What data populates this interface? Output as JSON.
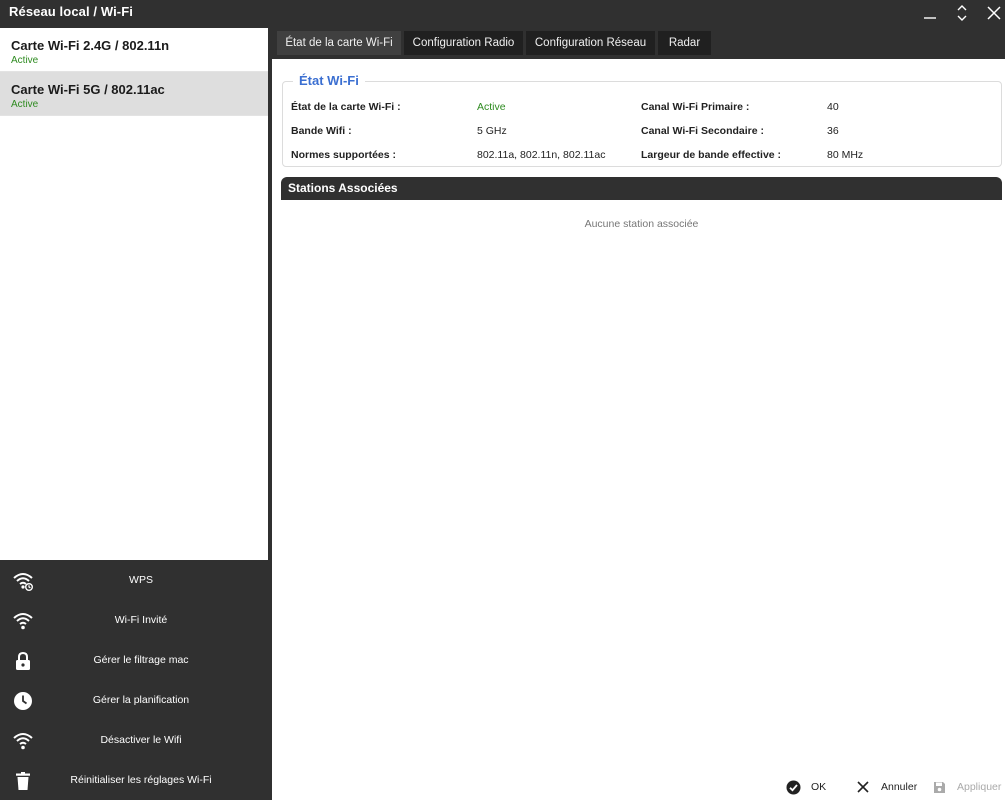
{
  "window": {
    "title": "Réseau local / Wi-Fi"
  },
  "sidebar": {
    "cards": [
      {
        "name": "Carte Wi-Fi 2.4G / 802.11n",
        "status": "Active"
      },
      {
        "name": "Carte Wi-Fi 5G / 802.11ac",
        "status": "Active"
      }
    ],
    "actions": [
      {
        "label": "WPS",
        "icon": "wps-icon"
      },
      {
        "label": "Wi-Fi Invité",
        "icon": "wifi-icon"
      },
      {
        "label": "Gérer le filtrage mac",
        "icon": "lock-icon"
      },
      {
        "label": "Gérer la planification",
        "icon": "clock-icon"
      },
      {
        "label": "Désactiver le Wifi",
        "icon": "wifi-icon"
      },
      {
        "label": "Réinitialiser les réglages Wi-Fi",
        "icon": "trash-icon"
      }
    ]
  },
  "tabs": [
    {
      "label": "État de la carte Wi-Fi"
    },
    {
      "label": "Configuration Radio"
    },
    {
      "label": "Configuration Réseau"
    },
    {
      "label": "Radar"
    }
  ],
  "wifi_state": {
    "legend": "État Wi-Fi",
    "left": [
      {
        "label": "État de la carte Wi-Fi :",
        "value": "Active"
      },
      {
        "label": "Bande Wifi :",
        "value": "5 GHz"
      },
      {
        "label": "Normes supportées :",
        "value": "802.11a, 802.11n, 802.11ac"
      }
    ],
    "right": [
      {
        "label": "Canal Wi-Fi Primaire :",
        "value": "40"
      },
      {
        "label": "Canal Wi-Fi Secondaire :",
        "value": "36"
      },
      {
        "label": "Largeur de bande effective :",
        "value": "80 MHz"
      }
    ]
  },
  "stations": {
    "title": "Stations Associées",
    "empty_text": "Aucune station associée"
  },
  "footer": {
    "ok_label": "OK",
    "cancel_label": "Annuler",
    "apply_label": "Appliquer"
  },
  "colors": {
    "accent": "#3b6fd1",
    "status_active": "#2e8b20",
    "dark_bg": "#303030"
  }
}
